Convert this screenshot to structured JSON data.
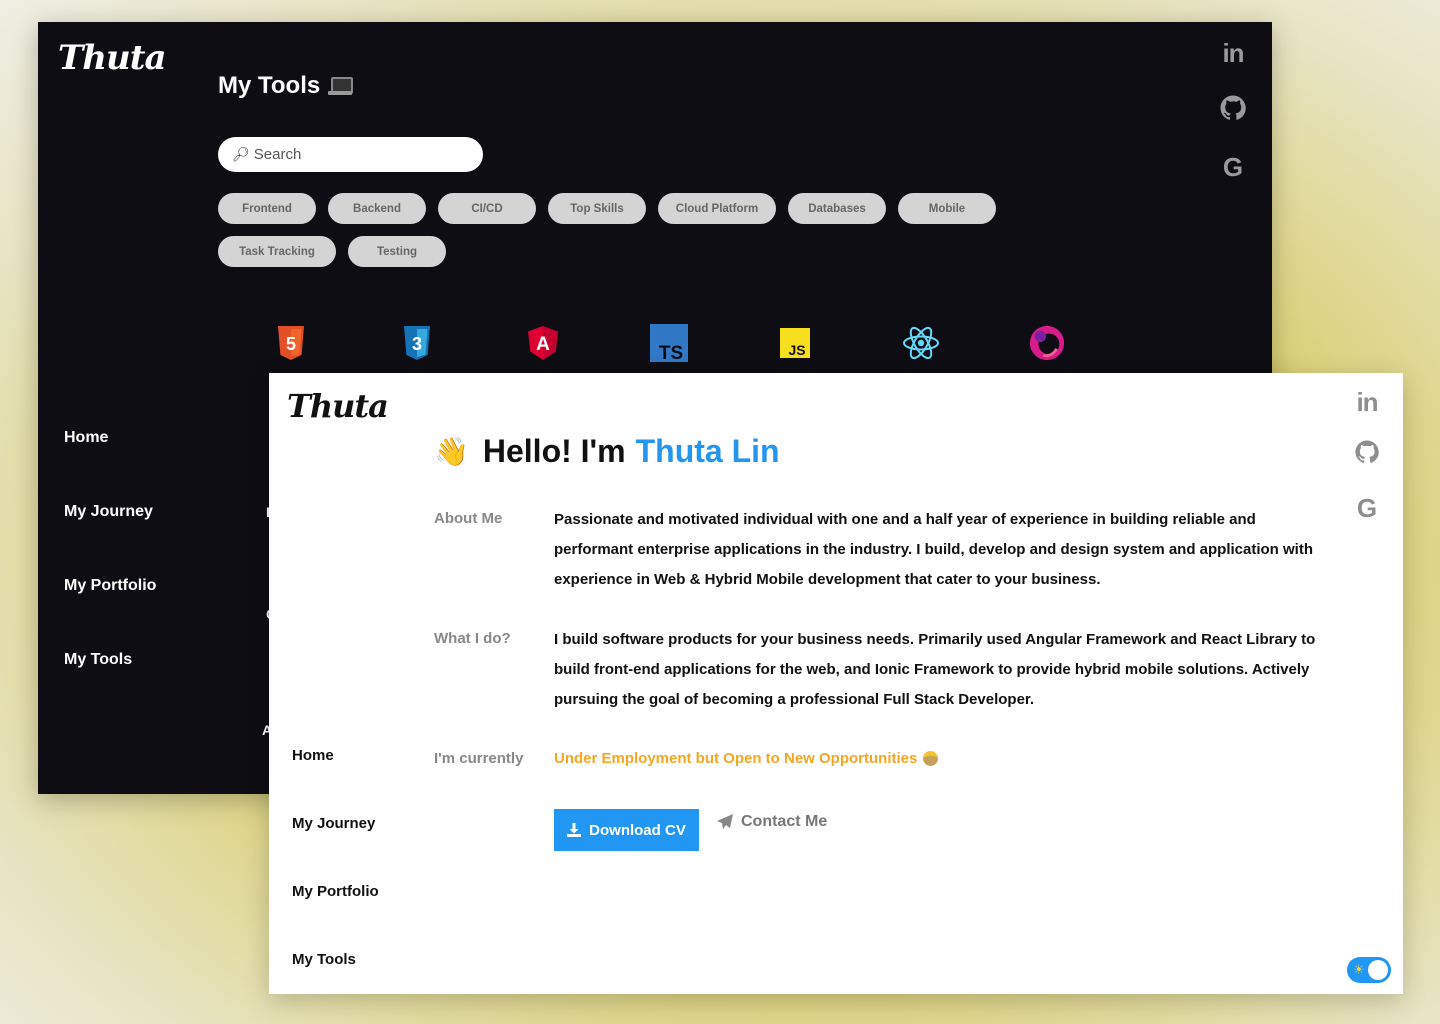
{
  "dark_window": {
    "logo": "Thuta",
    "title": "My Tools",
    "search": {
      "placeholder": "Search",
      "icon": "magnifier-icon"
    },
    "filter_chips_row1": [
      "Frontend",
      "Backend",
      "CI/CD",
      "Top Skills",
      "Cloud Platform",
      "Databases",
      "Mobile"
    ],
    "filter_chips_row2": [
      "Task Tracking",
      "Testing"
    ],
    "tools": [
      {
        "icon": "html5-icon",
        "label": "5",
        "color": "#e34f26"
      },
      {
        "icon": "css3-icon",
        "label": "3",
        "color": "#1572b6"
      },
      {
        "icon": "angular-icon",
        "label": "A",
        "color": "#dd0031"
      },
      {
        "icon": "typescript-icon",
        "label": "TS",
        "color": "#3178c6"
      },
      {
        "icon": "javascript-icon",
        "label": "JS",
        "color": "#f7df1e"
      },
      {
        "icon": "react-icon",
        "label": "",
        "color": "#61dafb"
      },
      {
        "icon": "rxjs-icon",
        "label": "",
        "color": "#d81b8a"
      }
    ],
    "nav": [
      "Home",
      "My Journey",
      "My Portfolio",
      "My Tools"
    ],
    "social": [
      "linkedin-icon",
      "github-icon",
      "google-icon"
    ],
    "peek_letters": [
      "I",
      "C",
      "A"
    ]
  },
  "light_window": {
    "logo": "Thuta",
    "greeting": "Hello! I'm",
    "name": "Thuta Lin",
    "about_label": "About Me",
    "about_text": "Passionate and motivated individual with one and a half year of experience in building reliable and performant enterprise applications in the industry. I build, develop and design system and application with experience in Web & Hybrid Mobile development that cater to your business.",
    "whatido_label": "What I do?",
    "whatido_text": "I build software products for your business needs. Primarily used Angular Framework and React Library to build front-end applications for the web, and Ionic Framework to provide hybrid mobile solutions. Actively pursuing the goal of becoming a professional Full Stack Developer.",
    "current_label": "I'm currently",
    "current_status": "Under Employment but Open to New Opportunities",
    "download_label": "Download CV",
    "contact_label": "Contact Me",
    "nav": [
      "Home",
      "My Journey",
      "My Portfolio",
      "My Tools"
    ],
    "social": [
      "linkedin-icon",
      "github-icon",
      "google-icon"
    ],
    "theme_toggle": "sun-icon"
  },
  "colors": {
    "accent": "#2196f3",
    "name_blue": "#2596ee",
    "status_orange": "#f5a623",
    "dark_bg": "#0e0d14"
  }
}
